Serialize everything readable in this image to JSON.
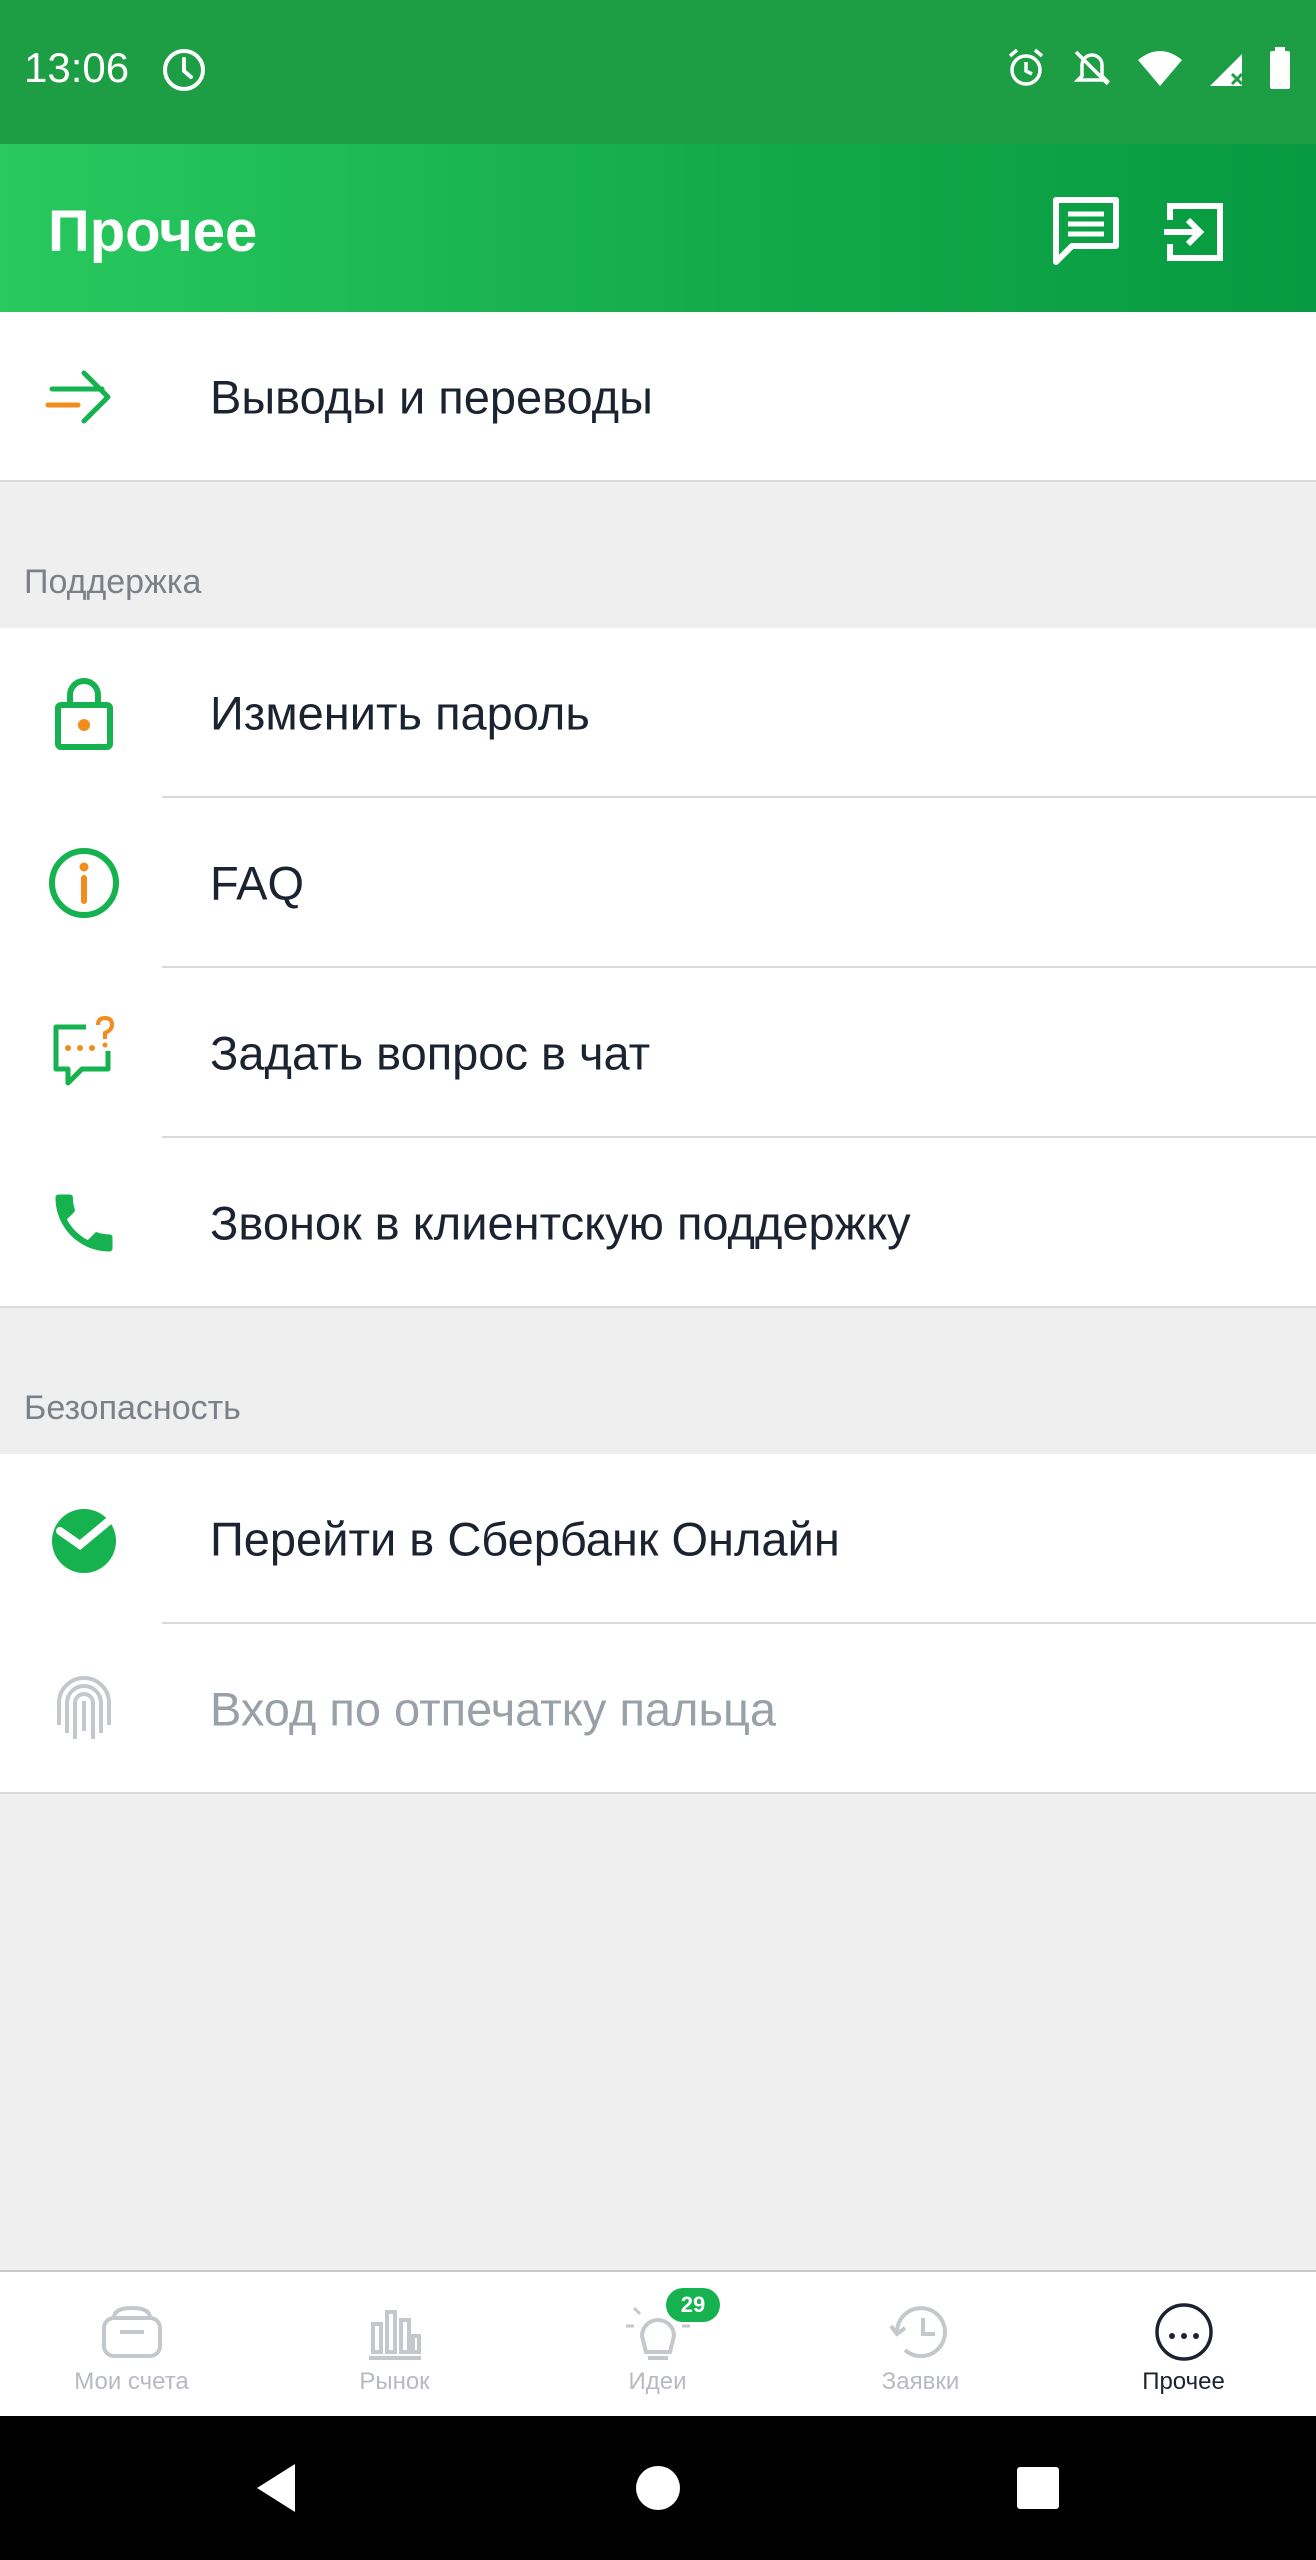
{
  "status_bar": {
    "time": "13:06"
  },
  "app_bar": {
    "title": "Прочее"
  },
  "rows": {
    "withdrawals": "Выводы и переводы",
    "change_password": "Изменить пароль",
    "faq": "FAQ",
    "chat": "Задать вопрос в чат",
    "call": "Звонок в клиентскую поддержку",
    "sberbank_online": "Перейти в Сбербанк Онлайн",
    "fingerprint": "Вход по отпечатку пальца"
  },
  "sections": {
    "support": "Поддержка",
    "security": "Безопасность"
  },
  "bottom_nav": {
    "items": [
      {
        "label": "Мои счета",
        "icon": "wallet-icon"
      },
      {
        "label": "Рынок",
        "icon": "bar-chart-icon"
      },
      {
        "label": "Идеи",
        "icon": "lightbulb-icon",
        "badge": "29"
      },
      {
        "label": "Заявки",
        "icon": "history-icon"
      },
      {
        "label": "Прочее",
        "icon": "more-icon",
        "active": true
      }
    ]
  },
  "colors": {
    "accent": "#16b24f",
    "orange": "#f28c1c",
    "text": "#1c2330",
    "muted": "#7c8088"
  }
}
